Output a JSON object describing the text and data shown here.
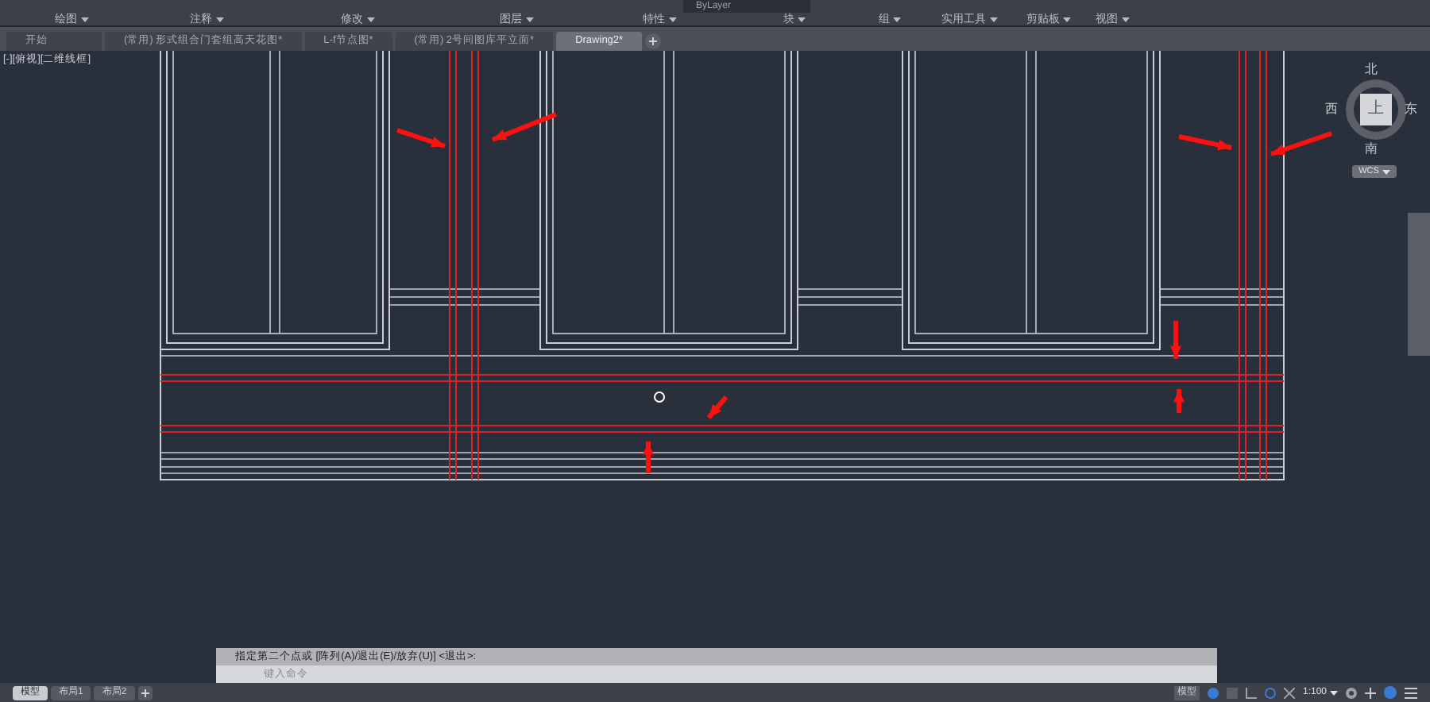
{
  "ribbon": {
    "layer_value": "ByLayer",
    "panels": [
      "绘图",
      "注释",
      "修改",
      "图层",
      "特性",
      "块",
      "组",
      "实用工具",
      "剪贴板",
      "视图"
    ]
  },
  "file_tabs": [
    {
      "label": "开始",
      "selected": false
    },
    {
      "label": "(常用) 形式组合门套组高天花图*",
      "selected": false
    },
    {
      "label": "L-f节点图*",
      "selected": false
    },
    {
      "label": "(常用) 2号间图库平立面*",
      "selected": false
    },
    {
      "label": "Drawing2*",
      "selected": true
    }
  ],
  "viewport": {
    "label": "[-][俯视][二维线框]"
  },
  "view_cube": {
    "north": "北",
    "south": "南",
    "east": "东",
    "west": "西",
    "top": "上",
    "ucs": "WCS"
  },
  "command_line": {
    "history": "指定第二个点或 [阵列(A)/退出(E)/放弃(U)] <退出>:",
    "placeholder": "键入命令"
  },
  "layout_tabs": [
    {
      "label": "模型",
      "selected": true
    },
    {
      "label": "布局1",
      "selected": false
    },
    {
      "label": "布局2",
      "selected": false
    }
  ],
  "status_bar": {
    "model": "模型",
    "scale": "1:100"
  }
}
